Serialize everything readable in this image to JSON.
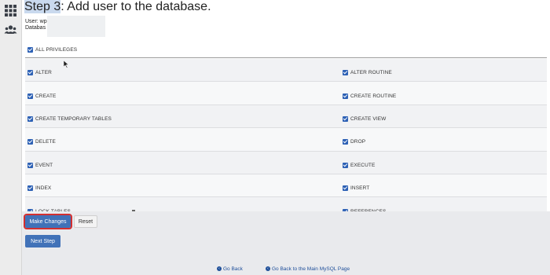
{
  "header": {
    "title_highlight": "Step 3",
    "title_rest": ": Add user to the database.",
    "user_label": "User: wp",
    "database_label": "Databas"
  },
  "privileges": {
    "all_label": "ALL PRIVILEGES",
    "rows": [
      {
        "left": "ALTER",
        "right": "ALTER ROUTINE"
      },
      {
        "left": "CREATE",
        "right": "CREATE ROUTINE"
      },
      {
        "left": "CREATE TEMPORARY TABLES",
        "right": "CREATE VIEW"
      },
      {
        "left": "DELETE",
        "right": "DROP"
      },
      {
        "left": "EVENT",
        "right": "EXECUTE"
      },
      {
        "left": "INDEX",
        "right": "INSERT"
      },
      {
        "left": "LOCK TABLES",
        "right": "REFERENCES"
      }
    ]
  },
  "actions": {
    "make_changes": "Make Changes",
    "reset": "Reset",
    "next_step": "Next Step"
  },
  "footer": {
    "go_back": "Go Back",
    "go_back_mysql": "Go Back to the Main MySQL Page"
  },
  "colors": {
    "accent": "#4172b8",
    "checkbox": "#2d61b5",
    "highlight_border": "#d32f2f"
  }
}
